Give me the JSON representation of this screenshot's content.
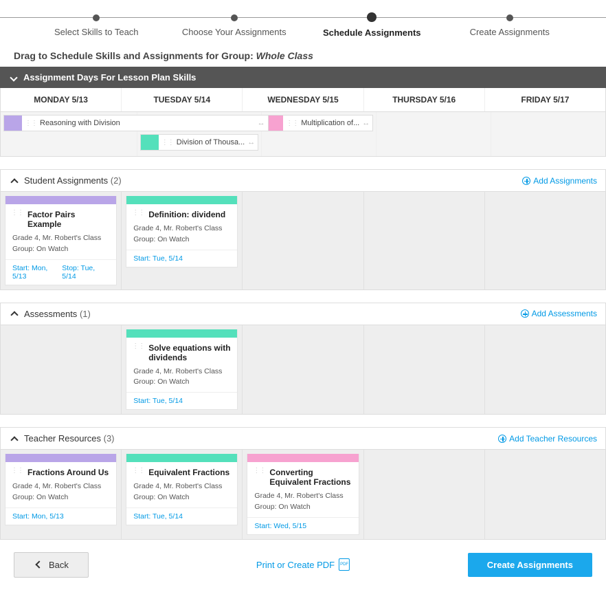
{
  "stepper": {
    "steps": [
      {
        "label": "Select Skills to Teach"
      },
      {
        "label": "Choose Your Assignments"
      },
      {
        "label": "Schedule Assignments",
        "active": true
      },
      {
        "label": "Create Assignments"
      }
    ]
  },
  "subtitle_prefix": "Drag to Schedule Skills and Assignments for Group: ",
  "group_name": "Whole Class",
  "assignment_days_header": "Assignment Days For Lesson Plan Skills",
  "days": [
    {
      "label": "MONDAY 5/13"
    },
    {
      "label": "TUESDAY 5/14"
    },
    {
      "label": "WEDNESDAY 5/15"
    },
    {
      "label": "THURSDAY 5/16"
    },
    {
      "label": "FRIDAY 5/17"
    }
  ],
  "skills": {
    "mon": [
      {
        "text": "Reasoning with Division",
        "color": "c-purple",
        "span": 2
      }
    ],
    "tue": [
      {
        "text": "Division of Thousa...",
        "color": "c-teal"
      }
    ],
    "wed": [
      {
        "text": "Multiplication of...",
        "color": "c-pink"
      }
    ]
  },
  "sections": {
    "student": {
      "title": "Student Assignments",
      "count": "(2)",
      "add": "Add Assignments",
      "cards": [
        {
          "day": 0,
          "color": "c-purple",
          "title": "Factor Pairs Example",
          "grade": "Grade 4, Mr. Robert's Class",
          "group": "Group: On Watch",
          "start": "Start: Mon, 5/13",
          "stop": "Stop: Tue, 5/14"
        },
        {
          "day": 1,
          "color": "c-teal",
          "title": "Definition: dividend",
          "grade": "Grade 4, Mr. Robert's Class",
          "group": "Group: On Watch",
          "start": "Start: Tue, 5/14"
        }
      ]
    },
    "assess": {
      "title": "Assessments",
      "count": "(1)",
      "add": "Add Assessments",
      "cards": [
        {
          "day": 1,
          "color": "c-teal",
          "title": "Solve equations with dividends",
          "grade": "Grade 4, Mr. Robert's Class",
          "group": "Group: On Watch",
          "start": "Start: Tue, 5/14"
        }
      ]
    },
    "teacher": {
      "title": "Teacher Resources",
      "count": "(3)",
      "add": "Add Teacher Resources",
      "cards": [
        {
          "day": 0,
          "color": "c-purple",
          "title": "Fractions Around Us",
          "grade": "Grade 4, Mr. Robert's Class",
          "group": "Group: On Watch",
          "start": "Start: Mon, 5/13"
        },
        {
          "day": 1,
          "color": "c-teal",
          "title": "Equivalent Fractions",
          "grade": "Grade 4, Mr. Robert's Class",
          "group": "Group: On Watch",
          "start": "Start: Tue, 5/14"
        },
        {
          "day": 2,
          "color": "c-pink",
          "title": "Converting Equivalent Fractions",
          "grade": "Grade 4, Mr. Robert's Class",
          "group": "Group: On Watch",
          "start": "Start: Wed, 5/15"
        }
      ]
    }
  },
  "footer": {
    "back": "Back",
    "print": "Print or Create PDF",
    "pdf": "PDF",
    "create": "Create Assignments"
  }
}
